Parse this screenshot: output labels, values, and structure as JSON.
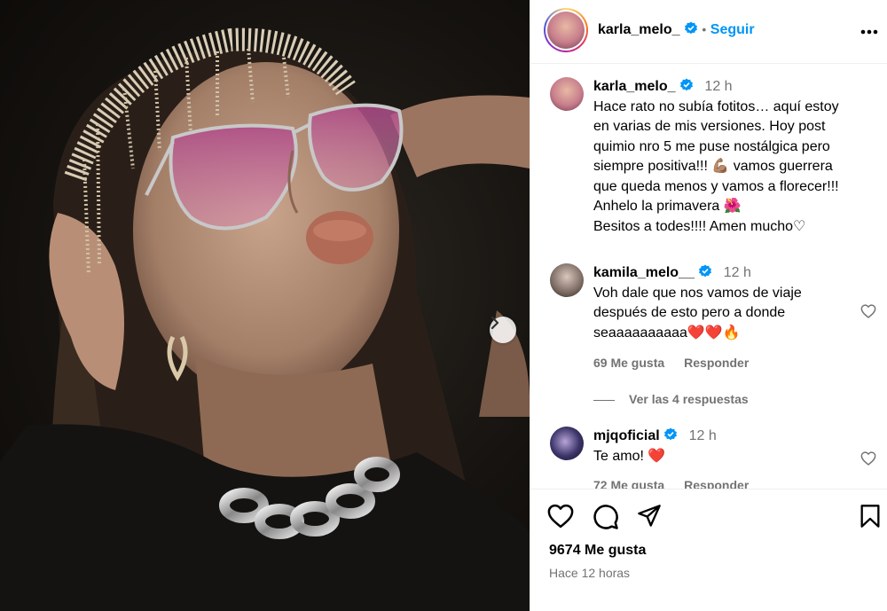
{
  "post": {
    "author": "karla_melo_",
    "follow_label": "Seguir",
    "separator": "•",
    "options_icon": "more-horizontal-icon"
  },
  "caption": {
    "username": "karla_melo_",
    "time": "12 h",
    "text_lines": [
      "Hace rato no subía fotitos… aquí estoy",
      "en varias de mis versiones. Hoy post",
      "quimio nro 5 me puse nostálgica pero",
      "siempre positiva!!! 💪🏽 vamos guerrera",
      "que queda menos y vamos a florecer!!!",
      "Anhelo la primavera 🌺",
      "Besitos a todes!!!! Amen mucho♡"
    ]
  },
  "comments": [
    {
      "username": "kamila_melo__",
      "time": "12 h",
      "text_lines": [
        "Voh dale que nos vamos de viaje",
        "después de esto pero a donde",
        "seaaaaaaaaaa❤️❤️🔥"
      ],
      "likes": "69 Me gusta",
      "reply_label": "Responder",
      "view_replies": "Ver las 4 respuestas"
    },
    {
      "username": "mjqoficial",
      "time": "12 h",
      "text_lines": [
        "Te amo! ❤️"
      ],
      "likes": "72 Me gusta",
      "reply_label": "Responder"
    }
  ],
  "footer": {
    "likes": "9674 Me gusta",
    "posted": "Hace 12 horas"
  },
  "colors": {
    "accent": "#0095f6",
    "secondary_text": "#737373",
    "border": "#efefef"
  },
  "icons": [
    "verified-badge-icon",
    "heart-icon",
    "comment-icon",
    "share-icon",
    "bookmark-icon",
    "chevron-right-icon"
  ]
}
